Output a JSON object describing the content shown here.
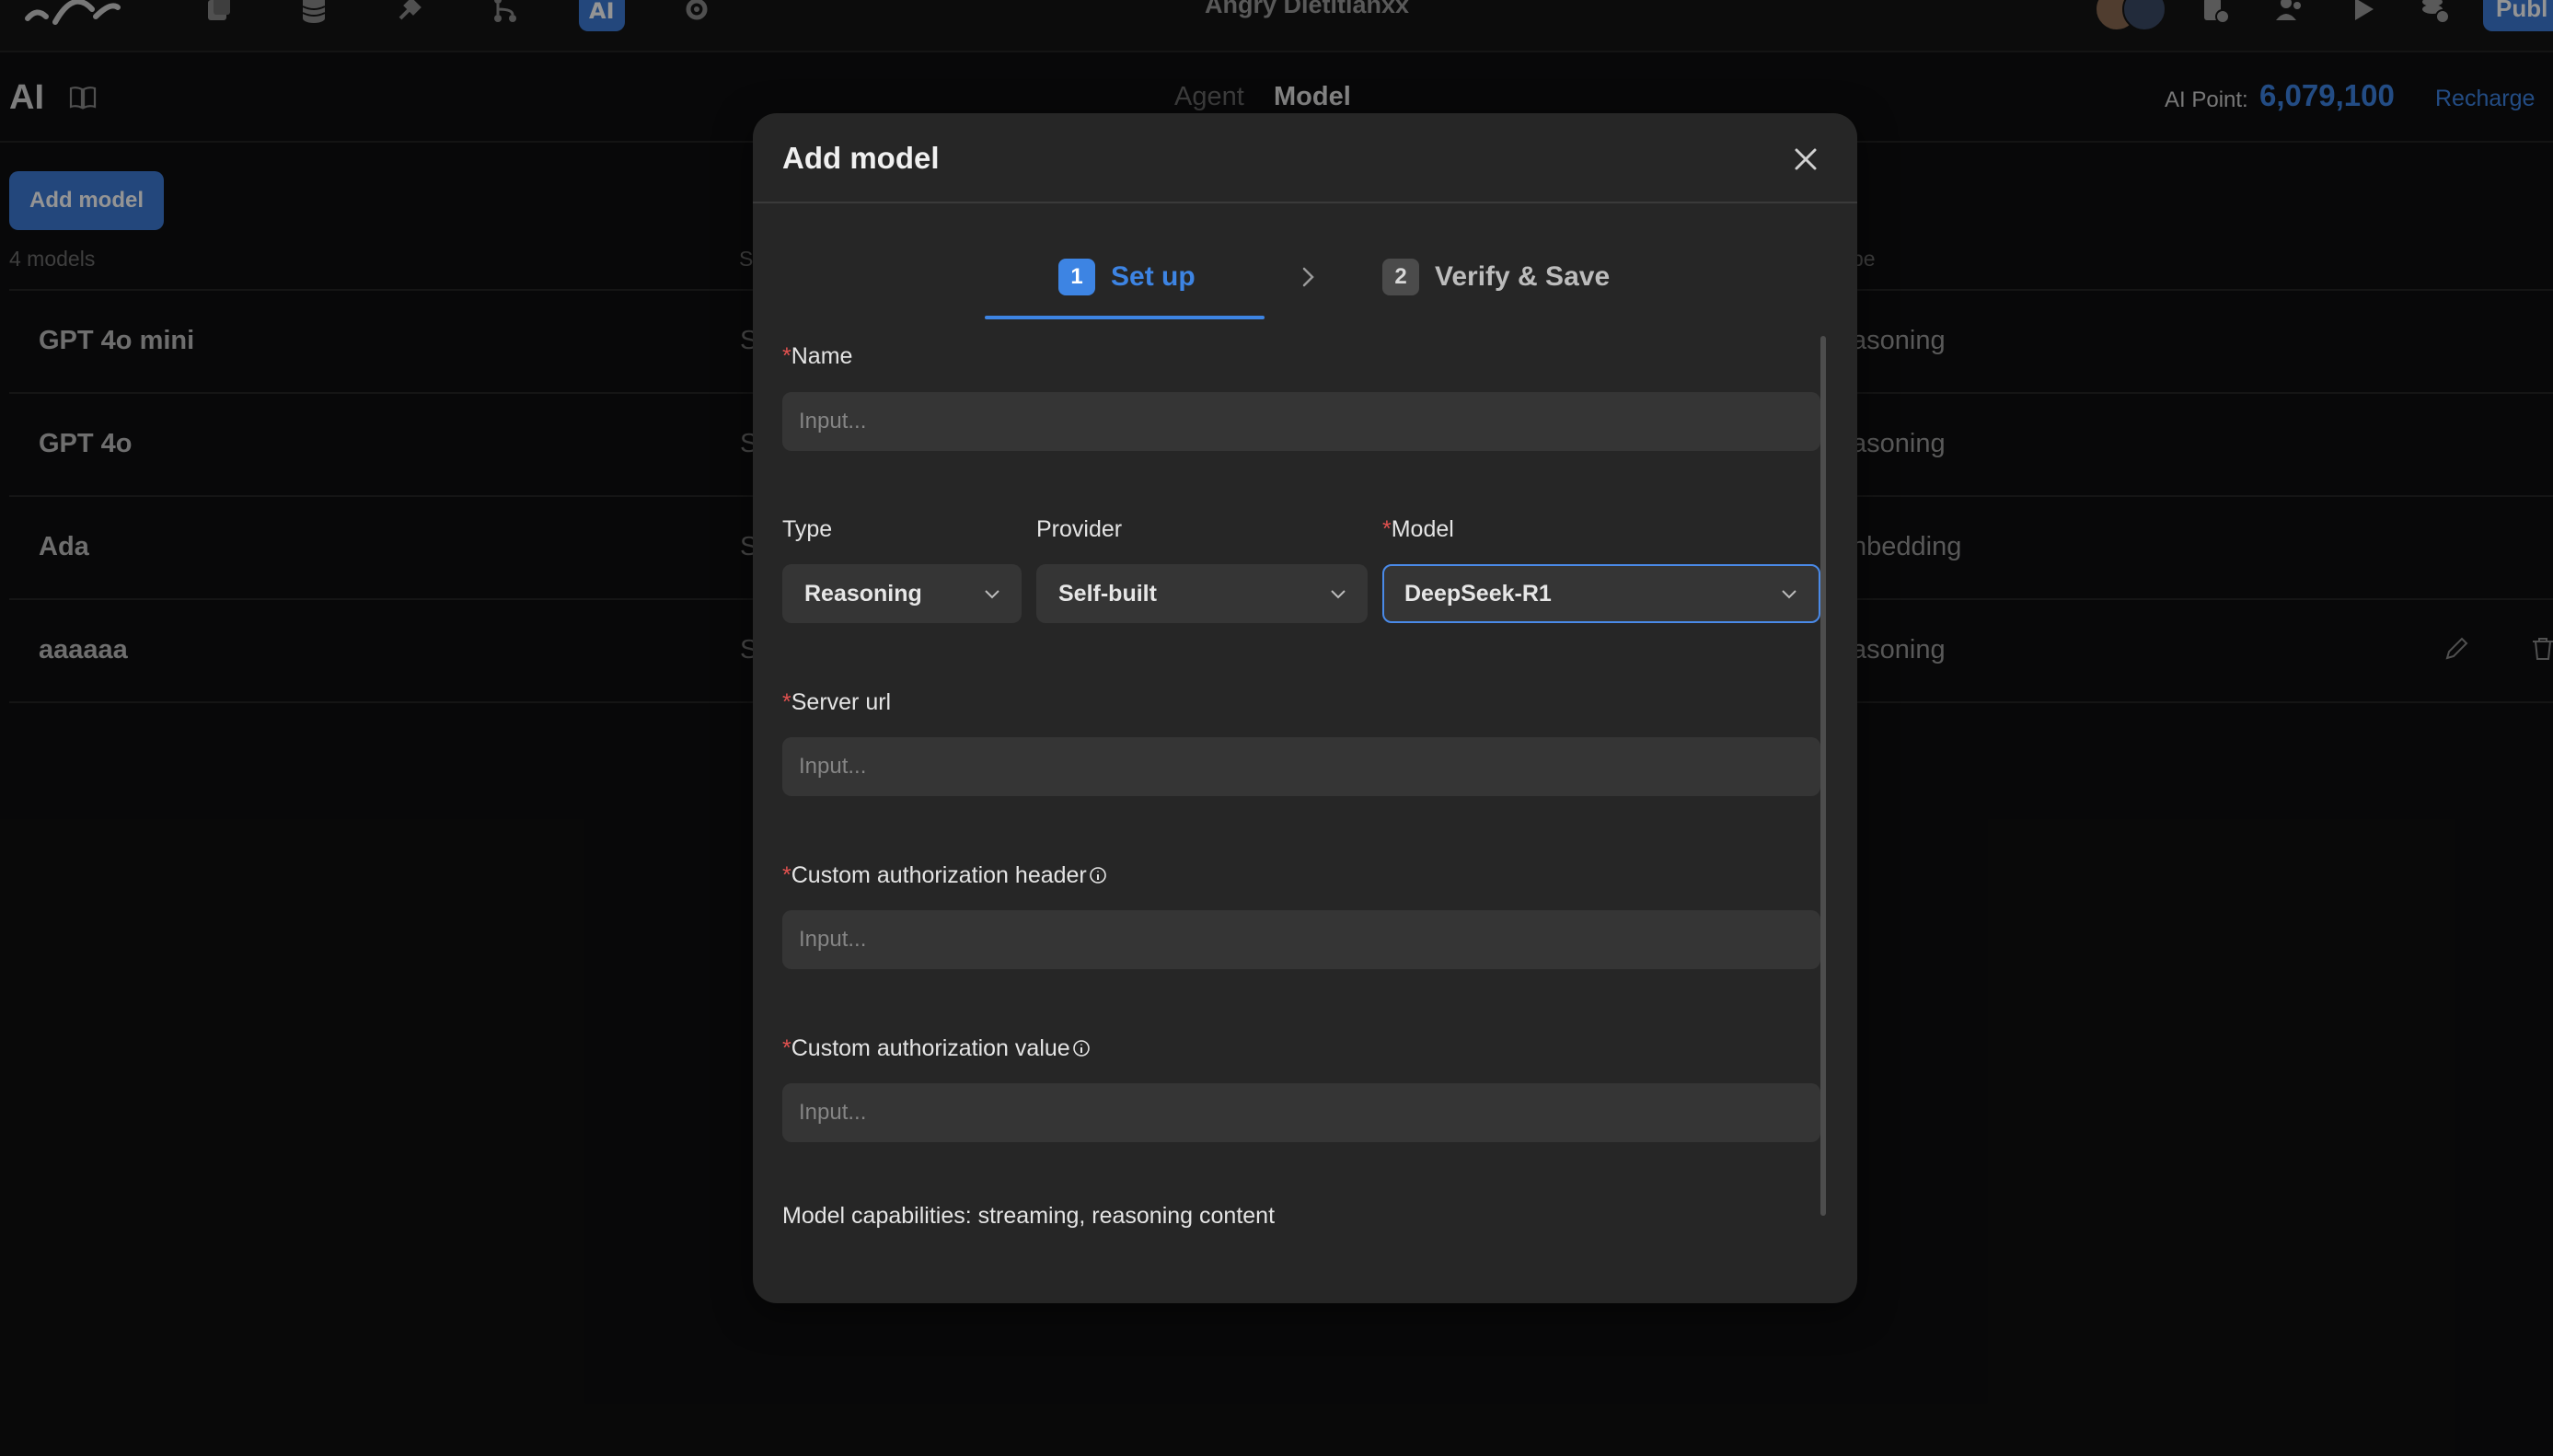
{
  "topbar": {
    "workspace_title": "Angry Dietitianxx",
    "publish_label": "Publ",
    "nav_icons": [
      "pages-icon",
      "database-icon",
      "plugin-icon",
      "workflow-icon",
      "ai-icon",
      "settings-icon"
    ],
    "right_icons": [
      "app-settings-icon",
      "users-icon",
      "play-icon",
      "coins-icon"
    ]
  },
  "subheader": {
    "title": "AI",
    "tabs": [
      {
        "label": "Agent",
        "active": false
      },
      {
        "label": "Model",
        "active": true
      }
    ],
    "points_label": "AI Point:",
    "points_value": "6,079,100",
    "recharge_label": "Recharge"
  },
  "model_list": {
    "add_button_label": "Add model",
    "count_label": "4 models",
    "header_s": "S",
    "header_type": "pe",
    "rows": [
      {
        "name": "GPT 4o mini",
        "s": "S",
        "type": "asoning"
      },
      {
        "name": "GPT 4o",
        "s": "S",
        "type": "asoning"
      },
      {
        "name": "Ada",
        "s": "S",
        "type": "nbedding"
      },
      {
        "name": "aaaaaa",
        "s": "S",
        "type": "asoning"
      }
    ]
  },
  "modal": {
    "title": "Add model",
    "steps": [
      {
        "number": "1",
        "label": "Set up",
        "active": true
      },
      {
        "number": "2",
        "label": "Verify & Save",
        "active": false
      }
    ],
    "name": {
      "label": "Name",
      "required": true,
      "placeholder": "Input..."
    },
    "type": {
      "label": "Type",
      "value": "Reasoning"
    },
    "provider": {
      "label": "Provider",
      "value": "Self-built"
    },
    "model": {
      "label": "Model",
      "required": true,
      "value": "DeepSeek-R1"
    },
    "server_url": {
      "label": "Server url",
      "required": true,
      "placeholder": "Input..."
    },
    "auth_header": {
      "label": "Custom authorization header",
      "required": true,
      "placeholder": "Input..."
    },
    "auth_value": {
      "label": "Custom authorization value",
      "required": true,
      "placeholder": "Input..."
    },
    "capabilities": "Model capabilities: streaming, reasoning content",
    "required_marker": "*"
  },
  "colors": {
    "accent": "#3d84e3",
    "required": "#e0514f",
    "modal_bg": "#262626",
    "input_bg": "#353535"
  }
}
